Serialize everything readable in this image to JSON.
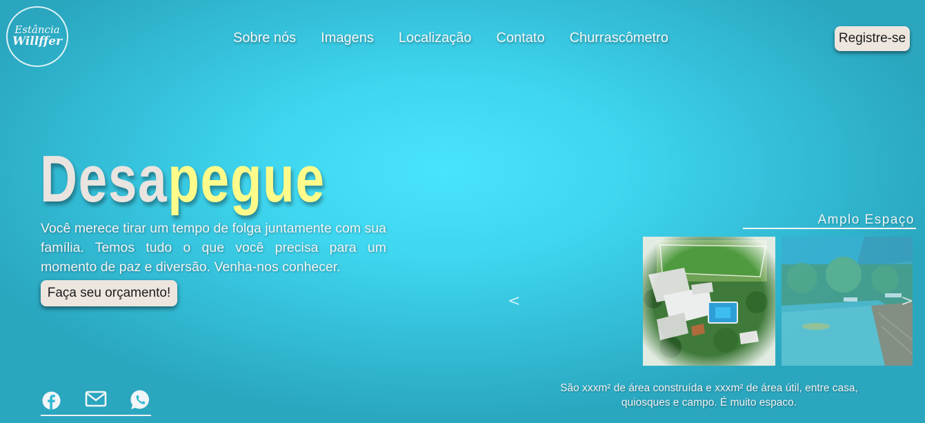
{
  "logo": {
    "line1": "Estância",
    "line2": "Willffer"
  },
  "nav": {
    "items": [
      {
        "label": "Sobre nós"
      },
      {
        "label": "Imagens"
      },
      {
        "label": "Localização"
      },
      {
        "label": "Contato"
      },
      {
        "label": "Churrascômetro"
      }
    ],
    "register_label": "Registre-se"
  },
  "hero": {
    "title_part1": "Desa",
    "title_part2": "pegue",
    "text": "Você merece tirar um tempo de folga juntamente com sua família. Temos tudo o que você precisa para um momento de paz e diversão. Venha-nos conhecer.",
    "cta_label": "Faça seu orçamento!"
  },
  "social": {
    "icons": [
      "facebook-icon",
      "mail-icon",
      "whatsapp-icon"
    ]
  },
  "carousel": {
    "title": "Amplo Espaço",
    "prev_symbol": "<",
    "next_symbol": ">",
    "caption": "São xxxm² de área construída e xxxm² de área útil, entre casa, quiosques e campo. É muito espaco."
  },
  "colors": {
    "accent_yellow": "#fffb8a",
    "button_bg": "#ece6df",
    "bg_center": "#48e4fc",
    "bg_edge": "#2aa6bf"
  }
}
